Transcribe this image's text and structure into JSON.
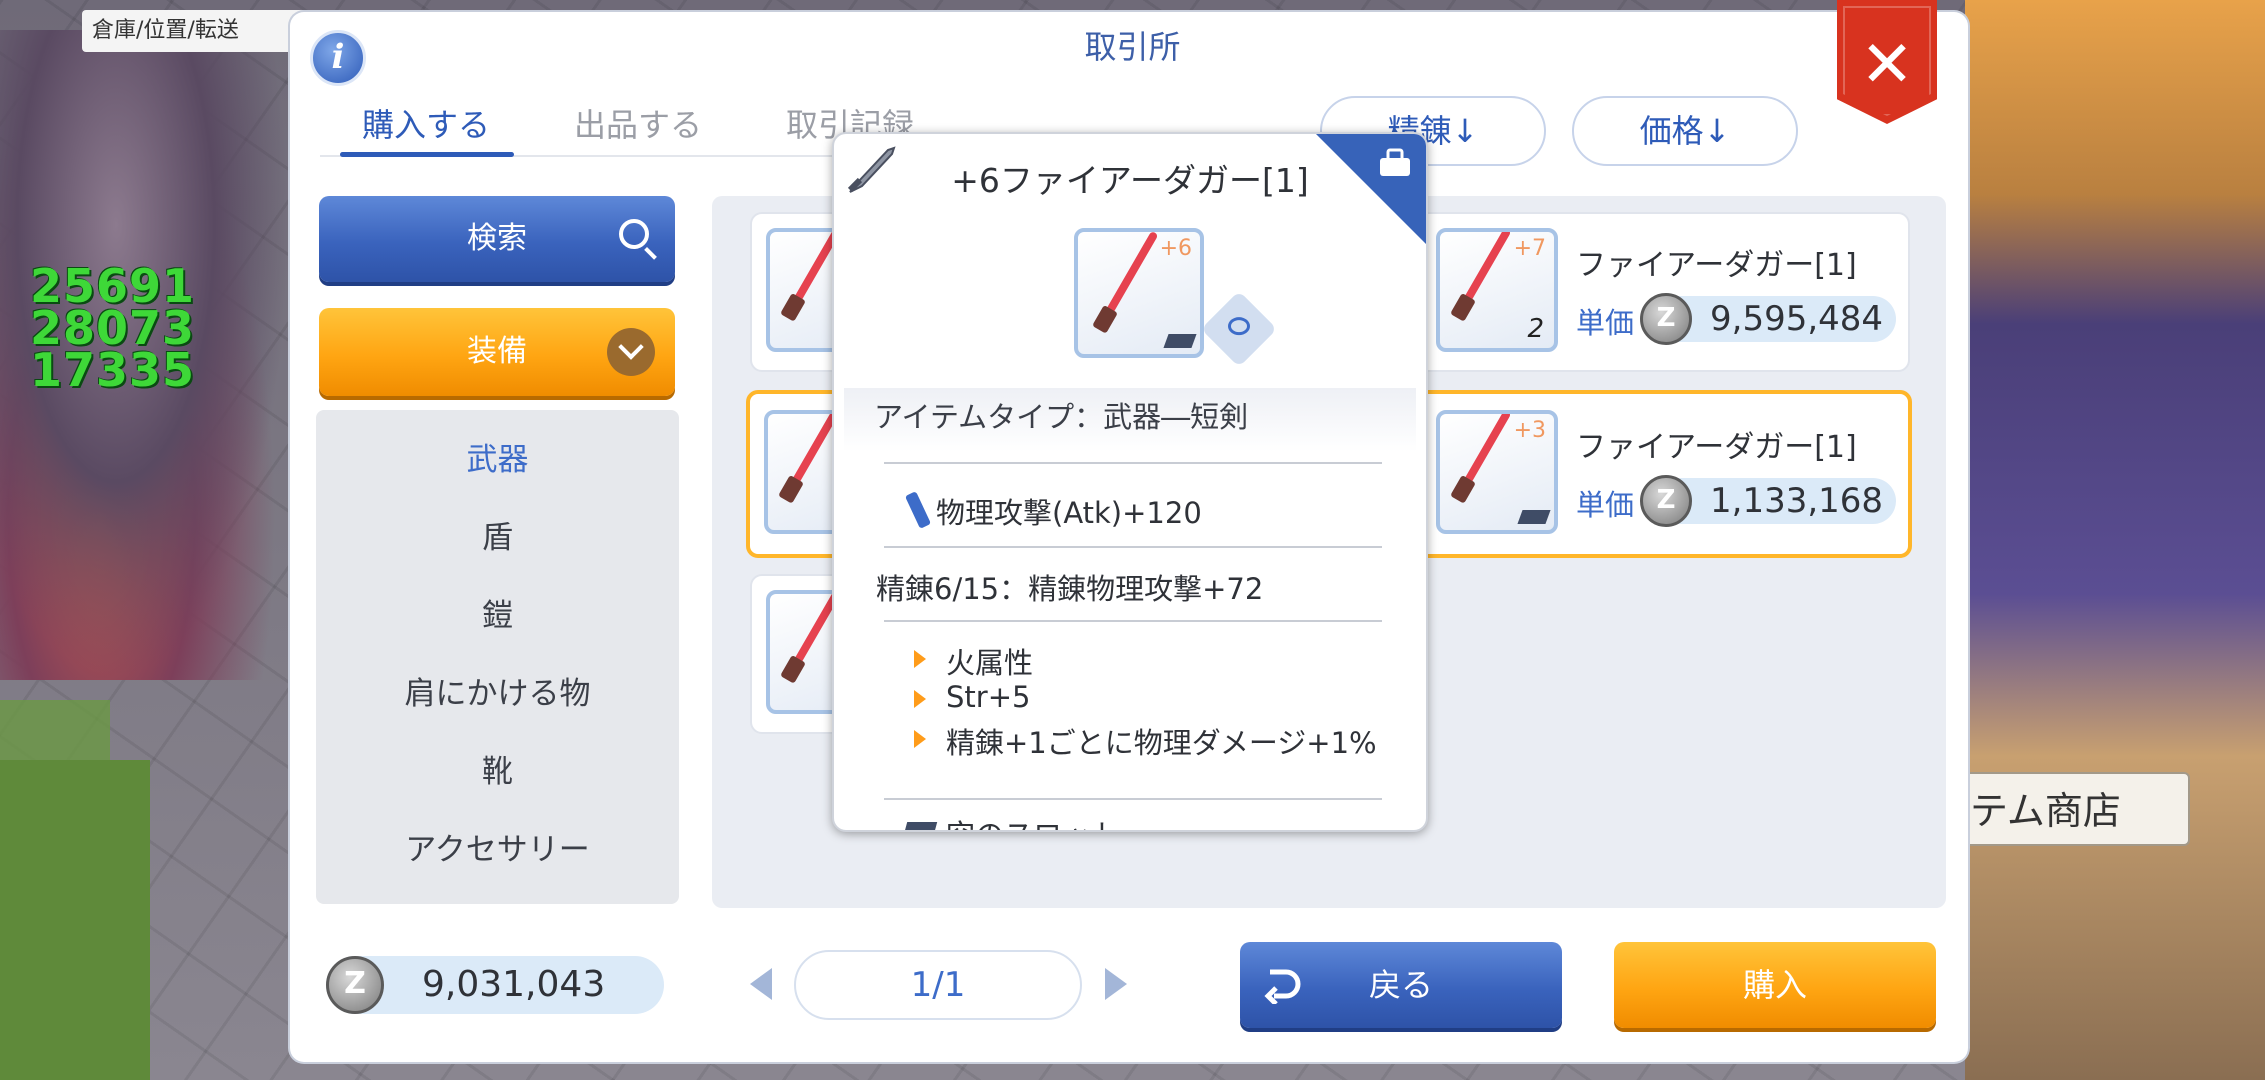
{
  "background": {
    "hud_label": "倉庫/位置/転送",
    "damage_numbers": [
      "25691",
      "28073",
      "17335"
    ],
    "shop_sign": "テム商店"
  },
  "window": {
    "title": "取引所",
    "info_symbol": "i",
    "close_symbol": "✕"
  },
  "tabs": [
    {
      "label": "購入する",
      "active": true
    },
    {
      "label": "出品する",
      "active": false
    },
    {
      "label": "取引記録",
      "active": false
    }
  ],
  "sort": {
    "refine_label": "精錬↓",
    "price_label": "価格↓"
  },
  "sidebar": {
    "search_label": "検索",
    "category_label": "装備",
    "items": [
      {
        "label": "武器",
        "active": true
      },
      {
        "label": "盾",
        "active": false
      },
      {
        "label": "鎧",
        "active": false
      },
      {
        "label": "肩にかける物",
        "active": false
      },
      {
        "label": "靴",
        "active": false
      },
      {
        "label": "アクセサリー",
        "active": false
      }
    ]
  },
  "listings": [
    {
      "name": "ファイアーダガー[1]",
      "price_label": "単価",
      "price": "9,595,484",
      "refine": "+7",
      "quantity": "2"
    },
    {
      "name": "ファイアーダガー[1]",
      "price_label": "単価",
      "price": "1,133,168",
      "refine": "+3",
      "quantity": ""
    }
  ],
  "tooltip": {
    "title": "+6ファイアーダガー[1]",
    "refine": "+6",
    "item_type": "アイテムタイプ：武器―短剣",
    "attack": "物理攻撃(Atk)+120",
    "refine_info": "精錬6/15：精錬物理攻撃+72",
    "effects": [
      "火属性",
      "Str+5",
      "精錬+1ごとに物理ダメージ+1%"
    ],
    "slot_label": "空のスロット"
  },
  "footer": {
    "zeny_symbol": "Z",
    "wallet": "9,031,043",
    "page": "1/1",
    "back_label": "戻る",
    "buy_label": "購入"
  },
  "colors": {
    "primary_blue": "#3a63bd",
    "accent_orange": "#ffa512",
    "close_red": "#d8331f",
    "text_blue": "#3d6cc9"
  },
  "icons": [
    "search-icon",
    "chevron-down-icon",
    "close-icon",
    "info-icon",
    "dagger-icon",
    "bag-icon",
    "eye-icon",
    "sword-icon",
    "slot-icon",
    "zeny-coin-icon",
    "back-arrow-icon",
    "arrow-left-icon",
    "arrow-right-icon"
  ]
}
